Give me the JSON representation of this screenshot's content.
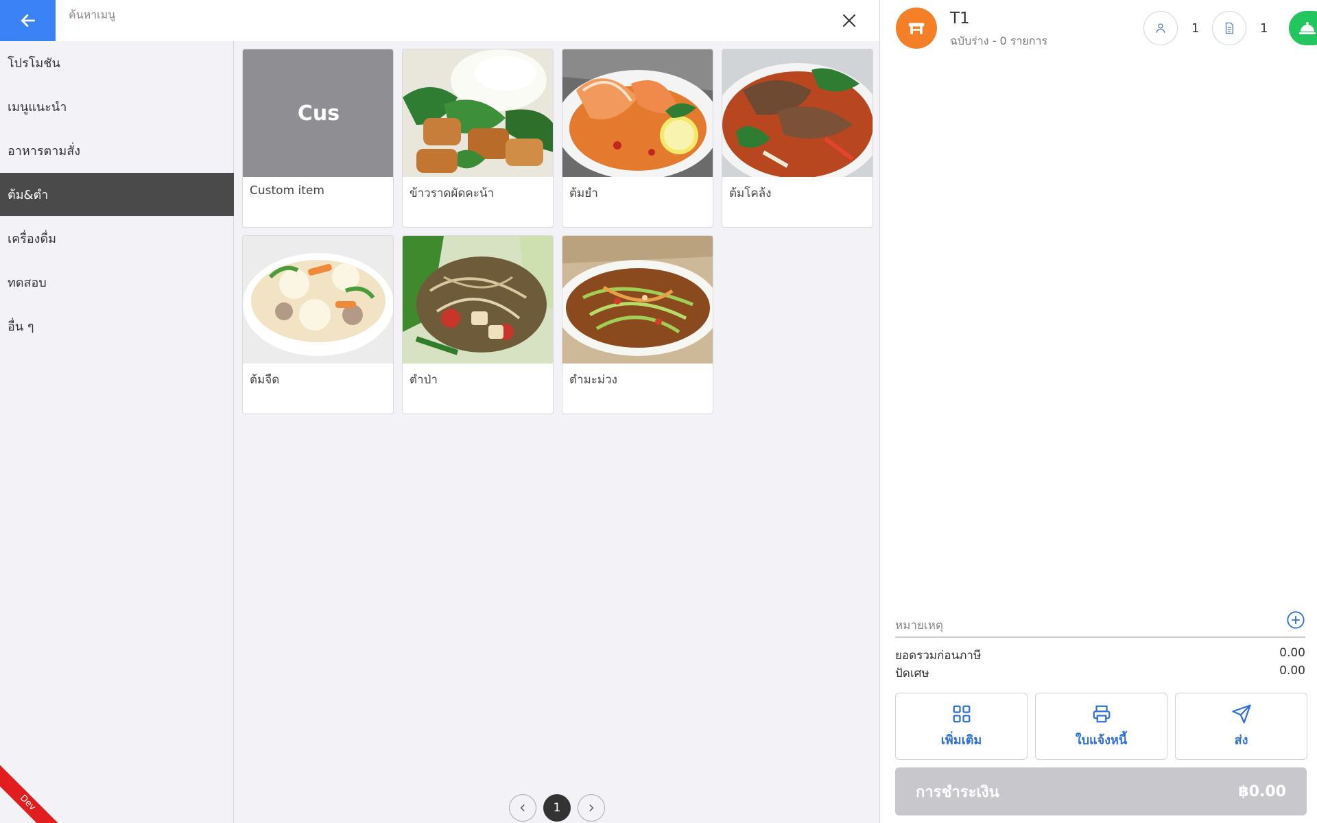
{
  "search": {
    "placeholder": "ค้นหาเมนู"
  },
  "categories": [
    {
      "label": "โปรโมชัน",
      "active": false
    },
    {
      "label": "เมนูแนะนำ",
      "active": false
    },
    {
      "label": "อาหารตามสั่ง",
      "active": false
    },
    {
      "label": "ต้ม&ตำ",
      "active": true
    },
    {
      "label": "เครื่องดื่ม",
      "active": false
    },
    {
      "label": "ทดสอบ",
      "active": false
    },
    {
      "label": "อื่น ๆ",
      "active": false
    }
  ],
  "menu_items": [
    {
      "label": "Custom item",
      "thumb_text": "Cus",
      "image": "gray placeholder"
    },
    {
      "label": "ข้าวราดผัดคะน้า",
      "image": "stir-fried kale with crispy pork and rice"
    },
    {
      "label": "ต้มยำ",
      "image": "tom yum shrimp soup"
    },
    {
      "label": "ต้มโคล้ง",
      "image": "tom klong smoked fish soup"
    },
    {
      "label": "ต้มจืด",
      "image": "clear soup with tofu and vegetables"
    },
    {
      "label": "ตำป่า",
      "image": "papaya salad with mixed vegetables"
    },
    {
      "label": "ตำมะม่วง",
      "image": "green mango salad"
    }
  ],
  "pagination": {
    "current": "1"
  },
  "dev_badge": "Dev",
  "order": {
    "table": "T1",
    "subtitle": "ฉบับร่าง - 0 รายการ",
    "guests": "1",
    "bills": "1",
    "note_label": "หมายเหตุ",
    "subtotal_label": "ยอดรวมก่อนภาษี",
    "subtotal_value": "0.00",
    "rounding_label": "ปัดเศษ",
    "rounding_value": "0.00",
    "actions": {
      "more": "เพิ่มเติม",
      "invoice": "ใบแจ้งหนี้",
      "send": "ส่ง"
    },
    "pay_label": "การชำระเงิน",
    "pay_amount": "฿0.00"
  },
  "colors": {
    "accent_blue": "#3b82f6",
    "active_category": "#4a4a4a",
    "table_icon": "#f47f26",
    "green": "#22c55e",
    "action_text": "#2f6fdc",
    "pay_disabled": "#c7c7cc"
  }
}
